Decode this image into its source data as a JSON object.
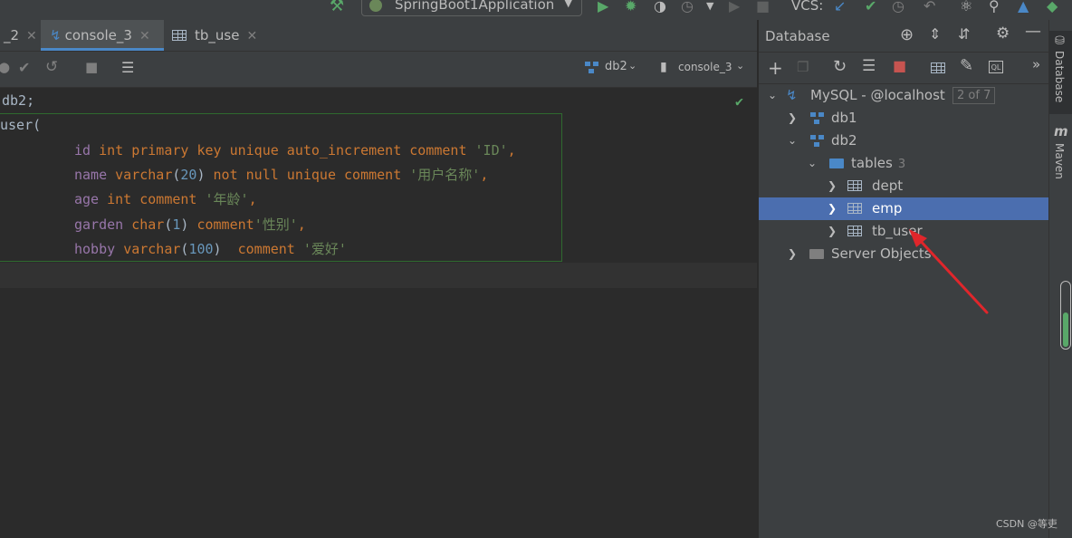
{
  "toolbar": {
    "run_config": "SpringBoot1Application",
    "vcs_label": "VCS:"
  },
  "editor_tabs": [
    {
      "label": "_2",
      "active": false
    },
    {
      "label": "console_3",
      "active": true
    },
    {
      "label": "tb_use",
      "active": false
    }
  ],
  "editor_toolbar": {
    "schema": "db2",
    "session": "console_3"
  },
  "code": {
    "line1": "db2;",
    "line2": "user(",
    "line3": {
      "field": "id",
      "type": "int",
      "mods": "primary key unique auto_increment comment",
      "comment": "'ID'",
      "tail": ","
    },
    "line4": {
      "field": "name",
      "type": "varchar",
      "size": "20",
      "mods": "not null unique comment",
      "comment": "'用户名称'",
      "tail": ","
    },
    "line5": {
      "field": "age",
      "type": "int",
      "mods": "comment",
      "comment": "'年龄'",
      "tail": ","
    },
    "line6": {
      "field": "garden",
      "type": "char",
      "size": "1",
      "mods": "comment",
      "comment": "'性别'",
      "tail": ","
    },
    "line7": {
      "field": "hobby",
      "type": "varchar",
      "size": "100",
      "mods": "comment",
      "comment": "'爱好'",
      "tail": ""
    }
  },
  "database_panel": {
    "title": "Database",
    "tree": {
      "connection": "MySQL - @localhost",
      "connection_badge": "2 of 7",
      "db1": "db1",
      "db2": "db2",
      "tables_label": "tables",
      "tables_count": "3",
      "tables": [
        "dept",
        "emp",
        "tb_user"
      ],
      "selected": "emp",
      "server_objects": "Server Objects"
    }
  },
  "side_tabs": {
    "database": "Database",
    "maven": "Maven"
  },
  "scroll_indicator_fill": 0.55,
  "watermark": "CSDN @等吏",
  "colors": {
    "selection": "#4b6eaf",
    "keyword": "#cc7832",
    "field": "#9876aa",
    "string": "#6a8759",
    "number": "#6897bb",
    "annotation_arrow": "#e0262b"
  }
}
